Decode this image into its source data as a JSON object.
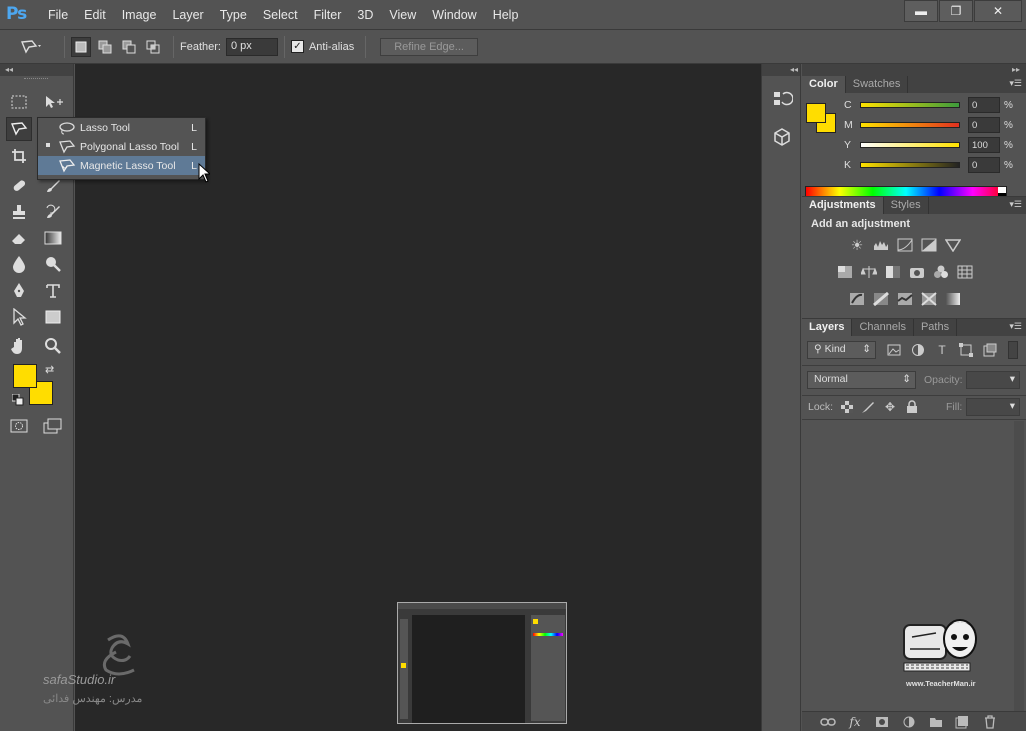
{
  "app": {
    "logo": "Ps"
  },
  "menu": [
    "File",
    "Edit",
    "Image",
    "Layer",
    "Type",
    "Select",
    "Filter",
    "3D",
    "View",
    "Window",
    "Help"
  ],
  "window_controls": {
    "minimize": "▬",
    "restore": "❐",
    "close": "✕"
  },
  "options": {
    "feather_label": "Feather:",
    "feather_value": "0 px",
    "antialias_label": "Anti-alias",
    "antialias_checked": "✓",
    "refine_edge_label": "Refine Edge..."
  },
  "toolbox": {
    "collapse": "◂◂"
  },
  "flyout": {
    "items": [
      {
        "label": "Lasso Tool",
        "key": "L"
      },
      {
        "label": "Polygonal Lasso Tool",
        "key": "L"
      },
      {
        "label": "Magnetic Lasso Tool",
        "key": "L"
      }
    ]
  },
  "colors": {
    "foreground": "#ffdd00",
    "background": "#ffdd00",
    "canvas": "#282828",
    "accent": "#4da7f0"
  },
  "panels": {
    "strip_label": "▸▸",
    "color_tabs": [
      "Color",
      "Swatches"
    ],
    "sliders": [
      {
        "label": "C",
        "value": "0",
        "unit": "%"
      },
      {
        "label": "M",
        "value": "0",
        "unit": "%"
      },
      {
        "label": "Y",
        "value": "100",
        "unit": "%"
      },
      {
        "label": "K",
        "value": "0",
        "unit": "%"
      }
    ],
    "adjust_tabs": [
      "Adjustments",
      "Styles"
    ],
    "adjust_heading": "Add an adjustment",
    "layers_tabs": [
      "Layers",
      "Channels",
      "Paths"
    ],
    "kind_label": "Kind",
    "blend_mode": "Normal",
    "opacity_label": "Opacity:",
    "lock_label": "Lock:",
    "fill_label": "Fill:"
  },
  "watermark": {
    "studio": "safaStudio.ir",
    "teacher_url": "www.TeacherMan.ir",
    "persian_caption": "مدرس: مهندس فدائی"
  }
}
